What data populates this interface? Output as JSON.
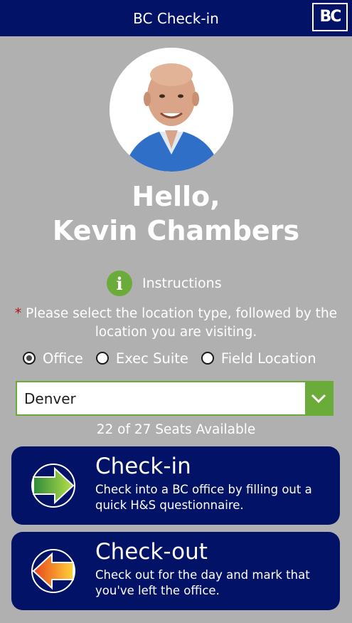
{
  "header": {
    "title": "BC Check-in",
    "logo_text": "BC"
  },
  "profile": {
    "greeting": "Hello,",
    "name": "Kevin Chambers"
  },
  "instructions": {
    "label": "Instructions",
    "icon": "info-icon",
    "icon_glyph": "i"
  },
  "location_prompt": {
    "required_marker": "*",
    "text": "Please select the location type, followed by the location you are visiting."
  },
  "location_types": {
    "selected": "Office",
    "options": [
      "Office",
      "Exec Suite",
      "Field Location"
    ]
  },
  "location_select": {
    "value": "Denver"
  },
  "seats": {
    "text": "22 of 27 Seats Available"
  },
  "actions": [
    {
      "title": "Check-in",
      "description": "Check into a BC office by filling out a quick H&S questionnaire.",
      "icon": "check-in-arrow-icon"
    },
    {
      "title": "Check-out",
      "description": "Check out for the day and mark that you've left the office.",
      "icon": "check-out-arrow-icon"
    }
  ],
  "colors": {
    "navy": "#021267",
    "green": "#6bab3a",
    "background": "#b0b0b0",
    "required": "#b01010"
  }
}
